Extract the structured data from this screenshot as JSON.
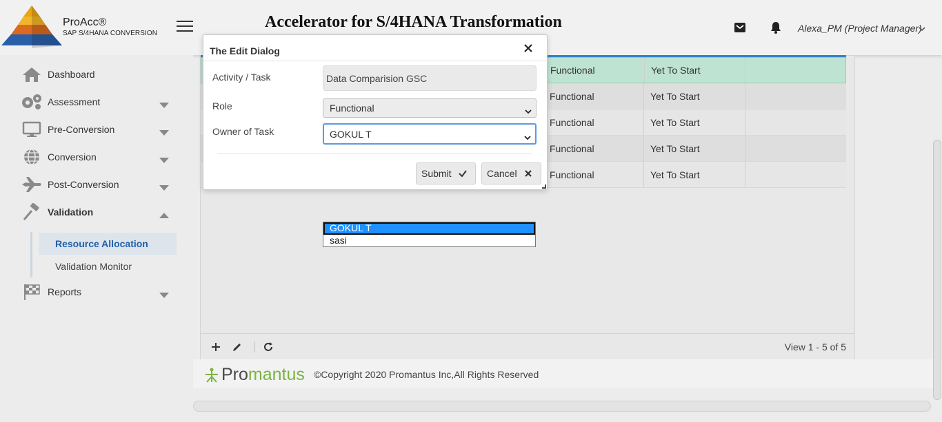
{
  "header": {
    "brand_name": "ProAcc®",
    "brand_sub": "SAP S/4HANA CONVERSION",
    "app_title": "Accelerator for S/4HANA Transformation",
    "user": "Alexa_PM (Project Manager)"
  },
  "sidebar": {
    "items": [
      {
        "label": "Dashboard",
        "icon": "home-icon"
      },
      {
        "label": "Assessment",
        "icon": "gears-icon"
      },
      {
        "label": "Pre-Conversion",
        "icon": "monitor-icon"
      },
      {
        "label": "Conversion",
        "icon": "globe-icon"
      },
      {
        "label": "Post-Conversion",
        "icon": "plane-icon"
      },
      {
        "label": "Validation",
        "icon": "gavel-icon"
      },
      {
        "label": "Reports",
        "icon": "checkered-flag-icon"
      }
    ],
    "sub_items": [
      {
        "label": "Resource Allocation",
        "active": true
      },
      {
        "label": "Validation Monitor",
        "active": false
      }
    ]
  },
  "grid": {
    "rows": [
      {
        "role": "Functional",
        "status": "Yet To Start"
      },
      {
        "role": "Functional",
        "status": "Yet To Start"
      },
      {
        "role": "Functional",
        "status": "Yet To Start"
      },
      {
        "role": "Functional",
        "status": "Yet To Start"
      },
      {
        "role": "Functional",
        "status": "Yet To Start"
      }
    ],
    "view_count": "View 1 - 5 of 5"
  },
  "dialog": {
    "title": "The Edit Dialog",
    "activity_label": "Activity / Task",
    "activity_value": "Data Comparision GSC",
    "role_label": "Role",
    "role_value": "Functional",
    "owner_label": "Owner of Task",
    "owner_value": "GOKUL T",
    "submit_label": "Submit",
    "cancel_label": "Cancel"
  },
  "dropdown": {
    "options": [
      "GOKUL T",
      "sasi"
    ],
    "highlighted_index": 0
  },
  "footer": {
    "brand_prefix": "Pro",
    "brand_suffix": "mantus",
    "copyright": "©Copyright 2020 Promantus Inc,All Rights Reserved"
  },
  "colors": {
    "accent": "#2e86c8",
    "selected_row": "#bfe3d2",
    "active_nav_text": "#1f5fa8",
    "dropdown_highlight": "#1e90ff",
    "brand_green": "#7cb342"
  }
}
